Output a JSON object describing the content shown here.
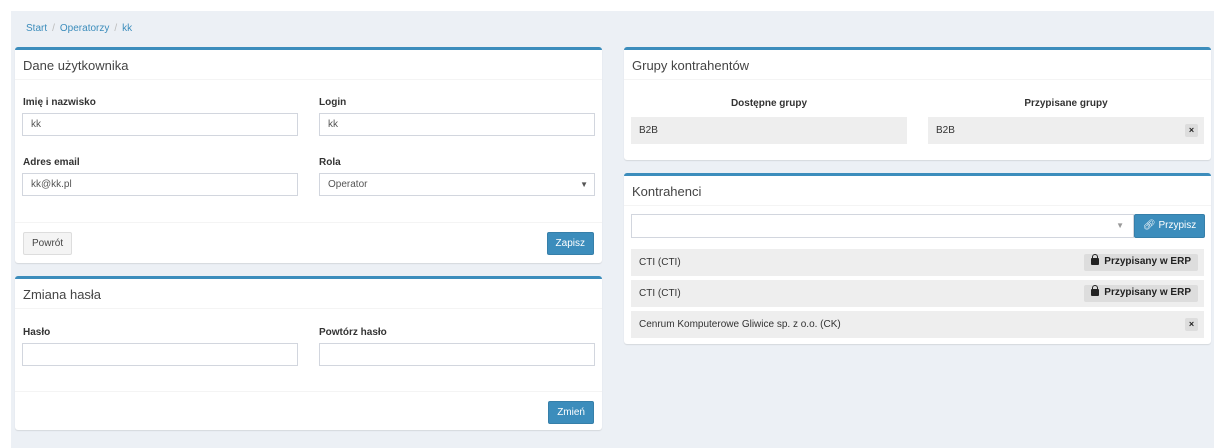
{
  "breadcrumb": {
    "start": "Start",
    "sep": "/",
    "operators": "Operatorzy",
    "current": "kk"
  },
  "user_data": {
    "title": "Dane użytkownika",
    "name_label": "Imię i nazwisko",
    "name_value": "kk",
    "login_label": "Login",
    "login_value": "kk",
    "email_label": "Adres email",
    "email_value": "kk@kk.pl",
    "role_label": "Rola",
    "role_value": "Operator",
    "back_label": "Powrót",
    "save_label": "Zapisz"
  },
  "password": {
    "title": "Zmiana hasła",
    "password_label": "Hasło",
    "password_value": "",
    "repeat_label": "Powtórz hasło",
    "repeat_value": "",
    "change_label": "Zmień"
  },
  "groups": {
    "title": "Grupy kontrahentów",
    "available_header": "Dostępne grupy",
    "assigned_header": "Przypisane grupy",
    "available": [
      "B2B"
    ],
    "assigned": [
      "B2B"
    ],
    "remove_glyph": "×"
  },
  "contractors": {
    "title": "Kontrahenci",
    "select_value": "",
    "assign_label": "Przypisz",
    "rows": [
      {
        "name": "CTI (CTI)",
        "badge": "Przypisany w ERP"
      },
      {
        "name": "CTI (CTI)",
        "badge": "Przypisany w ERP"
      },
      {
        "name": "Cenrum Komputerowe Gliwice sp. z o.o. (CK)",
        "badge": ""
      }
    ],
    "remove_glyph": "×"
  },
  "colors": {
    "accent": "#3c8dbc",
    "background": "#ecf0f5",
    "row_bg": "#eeeeee"
  }
}
